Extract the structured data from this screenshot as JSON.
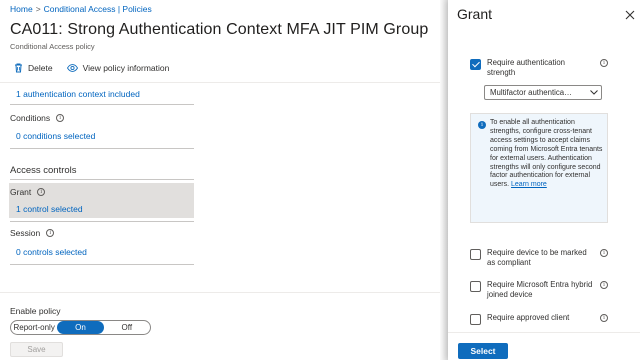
{
  "breadcrumb": {
    "items": [
      "Home",
      "Conditional Access | Policies"
    ],
    "separator": ">"
  },
  "page": {
    "title": "CA011: Strong Authentication Context MFA JIT PIM Group",
    "subtitle": "Conditional Access policy"
  },
  "toolbar": {
    "delete_label": "Delete",
    "view_label": "View policy information"
  },
  "auth_context_link": "1 authentication context included",
  "conditions": {
    "label": "Conditions",
    "value": "0 conditions selected"
  },
  "access_controls": {
    "title": "Access controls",
    "grant": {
      "label": "Grant",
      "value": "1 control selected"
    },
    "session": {
      "label": "Session",
      "value": "0 controls selected"
    }
  },
  "enable_policy": {
    "label": "Enable policy",
    "options": [
      "Report-only",
      "On",
      "Off"
    ],
    "selected": "On"
  },
  "save_label": "Save",
  "panel": {
    "title": "Grant",
    "require_auth_strength": {
      "label": "Require authentication strength",
      "checked": true
    },
    "auth_strength_select": "Multifactor authentica…",
    "info_text": "To enable all authentication strengths, configure cross-tenant access settings to accept claims coming from Microsoft Entra tenants for external users. Authentication strengths will only configure second factor authentication for external users.",
    "info_link": "Learn more",
    "require_compliant": {
      "label": "Require device to be marked as compliant",
      "checked": false
    },
    "require_hybrid": {
      "label": "Require Microsoft Entra hybrid joined device",
      "checked": false
    },
    "require_approved_client": {
      "label": "Require approved client",
      "checked": false
    },
    "select_label": "Select"
  },
  "colors": {
    "accent": "#0f6cbd",
    "link": "#0064bf",
    "grant_highlight": "#e1dfdd"
  },
  "icons": [
    "trash-icon",
    "eye-icon",
    "info-icon",
    "close-icon",
    "chevron-down-icon"
  ]
}
